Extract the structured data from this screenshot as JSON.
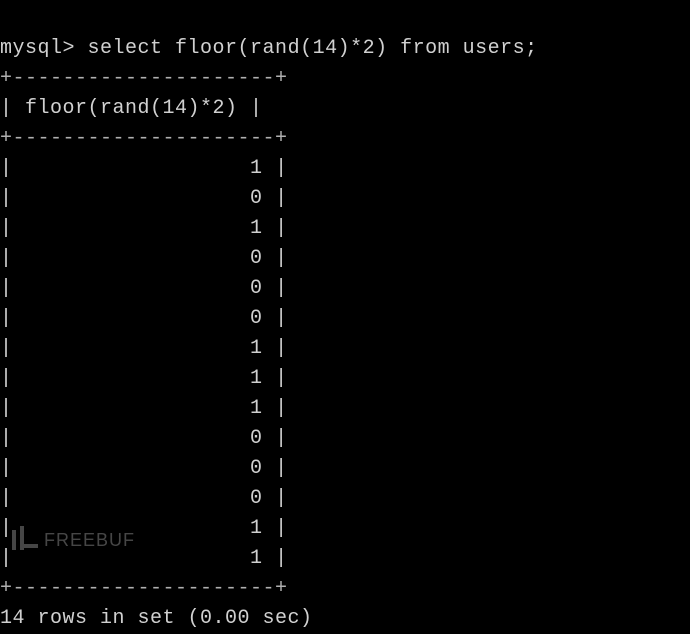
{
  "prompt": "mysql>",
  "query": "select floor(rand(14)*2) from users;",
  "table": {
    "border_top": "+---------------------+",
    "header_row": "| floor(rand(14)*2) |",
    "column_header": "floor(rand(14)*2)",
    "values": [
      1,
      0,
      1,
      0,
      0,
      0,
      1,
      1,
      1,
      0,
      0,
      0,
      1,
      1
    ]
  },
  "result_status": "14 rows in set (0.00 sec)",
  "row_count": 14,
  "query_time": "0.00 sec",
  "watermark": "FREEBUF"
}
